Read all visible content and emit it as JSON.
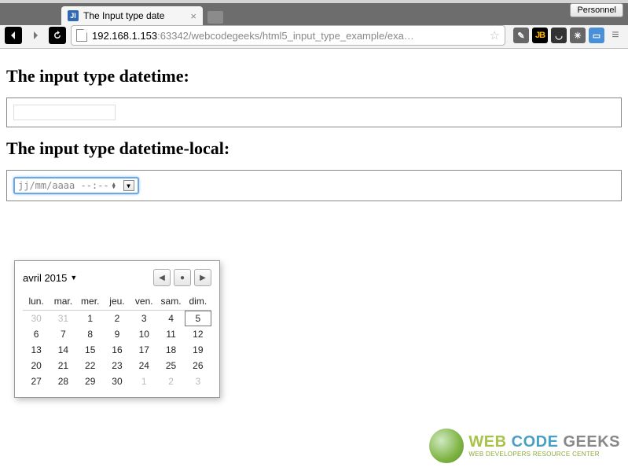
{
  "chrome": {
    "personnel_label": "Personnel",
    "tab_title": "The Input type date",
    "favicon_text": "JI",
    "url_host": "192.168.1.153",
    "url_port": ":63342",
    "url_path": "/webcodegeeks/html5_input_type_example/exa…",
    "ext_jb_label": "JB"
  },
  "page": {
    "heading_datetime": "The input type datetime:",
    "heading_datetime_local": "The input type datetime-local:",
    "datetime_local_value": "jj/mm/aaaa --:--"
  },
  "calendar": {
    "month_label": "avril 2015",
    "nav_prev": "◀",
    "nav_today": "●",
    "nav_next": "▶",
    "day_headers": [
      "lun.",
      "mar.",
      "mer.",
      "jeu.",
      "ven.",
      "sam.",
      "dim."
    ],
    "rows": [
      [
        {
          "d": "30",
          "off": true
        },
        {
          "d": "31",
          "off": true
        },
        {
          "d": "1"
        },
        {
          "d": "2"
        },
        {
          "d": "3"
        },
        {
          "d": "4"
        },
        {
          "d": "5"
        }
      ],
      [
        {
          "d": "6"
        },
        {
          "d": "7"
        },
        {
          "d": "8"
        },
        {
          "d": "9"
        },
        {
          "d": "10"
        },
        {
          "d": "11"
        },
        {
          "d": "12"
        }
      ],
      [
        {
          "d": "13"
        },
        {
          "d": "14"
        },
        {
          "d": "15"
        },
        {
          "d": "16"
        },
        {
          "d": "17"
        },
        {
          "d": "18"
        },
        {
          "d": "19"
        }
      ],
      [
        {
          "d": "20"
        },
        {
          "d": "21"
        },
        {
          "d": "22"
        },
        {
          "d": "23"
        },
        {
          "d": "24"
        },
        {
          "d": "25"
        },
        {
          "d": "26"
        }
      ],
      [
        {
          "d": "27"
        },
        {
          "d": "28"
        },
        {
          "d": "29"
        },
        {
          "d": "30"
        },
        {
          "d": "1",
          "off": true
        },
        {
          "d": "2",
          "off": true
        },
        {
          "d": "3",
          "off": true
        }
      ]
    ],
    "today": "5"
  },
  "watermark": {
    "word_web": "WEB ",
    "word_code": "CODE ",
    "word_geeks": "GEEKS",
    "subtitle": "WEB DEVELOPERS RESOURCE CENTER"
  }
}
